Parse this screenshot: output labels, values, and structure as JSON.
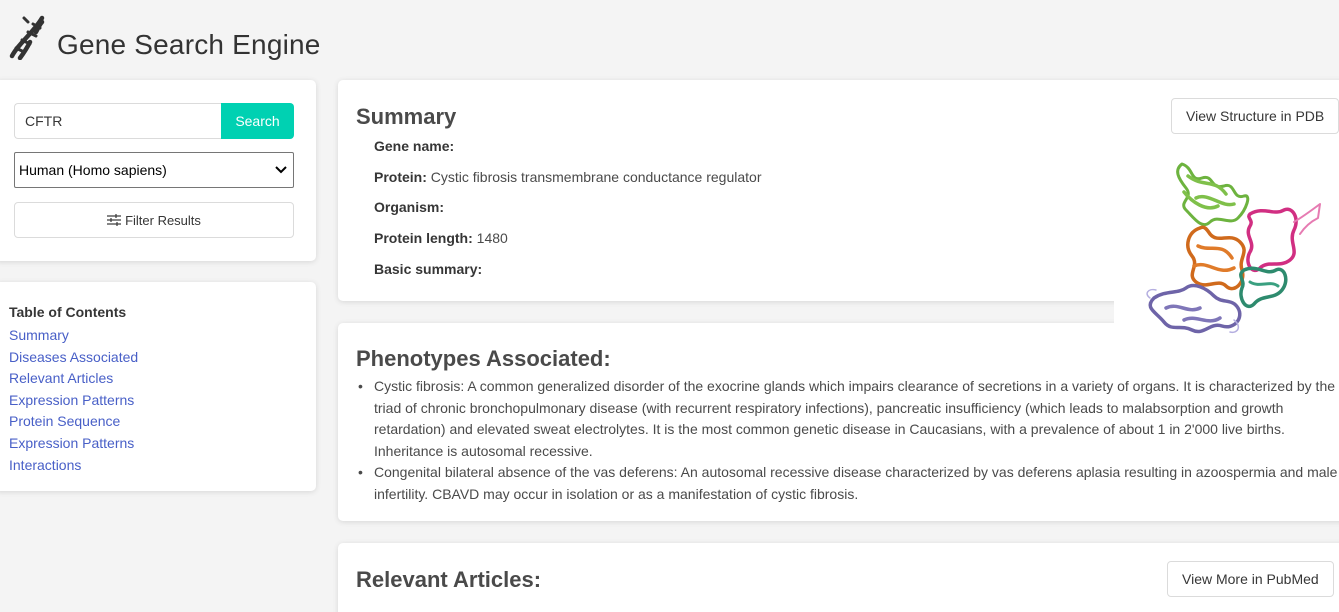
{
  "app": {
    "title": "Gene Search Engine"
  },
  "search": {
    "value": "CFTR",
    "button_label": "Search"
  },
  "species": {
    "selected": "Human (Homo sapiens)"
  },
  "filter": {
    "label": "Filter Results"
  },
  "toc": {
    "title": "Table of Contents",
    "items": [
      "Summary",
      "Diseases Associated",
      "Relevant Articles",
      "Expression Patterns",
      "Protein Sequence",
      "Expression Patterns",
      "Interactions"
    ]
  },
  "summary": {
    "title": "Summary",
    "pdb_button": "View Structure in PDB",
    "fields": [
      {
        "label": "Gene name:",
        "value": ""
      },
      {
        "label": "Protein:",
        "value": "Cystic fibrosis transmembrane conductance regulator"
      },
      {
        "label": "Organism:",
        "value": ""
      },
      {
        "label": "Protein length:",
        "value": "1480"
      },
      {
        "label": "Basic summary:",
        "value": ""
      }
    ]
  },
  "phenotypes": {
    "title": "Phenotypes Associated:",
    "items": [
      "Cystic fibrosis: A common generalized disorder of the exocrine glands which impairs clearance of secretions in a variety of organs. It is characterized by the triad of chronic bronchopulmonary disease (with recurrent respiratory infections), pancreatic insufficiency (which leads to malabsorption and growth retardation) and elevated sweat electrolytes. It is the most common genetic disease in Caucasians, with a prevalence of about 1 in 2'000 live births. Inheritance is autosomal recessive.",
      "Congenital bilateral absence of the vas deferens: An autosomal recessive disease characterized by vas deferens aplasia resulting in azoospermia and male infertility. CBAVD may occur in isolation or as a manifestation of cystic fibrosis."
    ]
  },
  "articles": {
    "title": "Relevant Articles:",
    "pubmed_button": "View More in PubMed"
  },
  "colors": {
    "accent": "#00d1b2",
    "link": "#485fc7",
    "background": "#f4f4f4"
  },
  "icons": {
    "logo": "dna-icon",
    "filter": "sliders-icon",
    "dropdown": "chevron-down-icon",
    "structure": "protein-structure-image"
  }
}
